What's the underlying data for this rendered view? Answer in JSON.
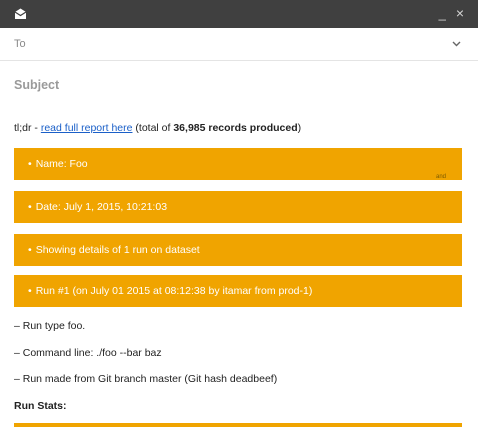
{
  "window": {
    "minimize_glyph": "_",
    "close_glyph": "×",
    "icon": "mail-envelope-icon"
  },
  "compose": {
    "to_label": "To",
    "subject_placeholder": "Subject"
  },
  "email": {
    "tldr_prefix": "tl;dr - ",
    "tldr_link": "read full report here",
    "tldr_mid": " (total of ",
    "tldr_count": "36,985 records produced",
    "tldr_suffix": ")",
    "bands": [
      {
        "bullet": "•",
        "text": "Name: Foo",
        "extra": "and"
      },
      {
        "bullet": "•",
        "text": "Date: July 1, 2015, 10:21:03"
      },
      {
        "bullet": "•",
        "text": "Showing details of 1 run on dataset"
      },
      {
        "bullet": "•",
        "text": "Run #1 (on July 01 2015 at 08:12:38 by itamar from prod-1)"
      }
    ],
    "lines": [
      "– Run type foo.",
      "– Command line: ./foo --bar baz",
      "– Run made from Git branch master (Git hash deadbeef)"
    ],
    "stats_heading": "Run Stats:"
  },
  "colors": {
    "titlebar": "#404040",
    "band": "#f0a400",
    "link": "#1a5fc8"
  }
}
